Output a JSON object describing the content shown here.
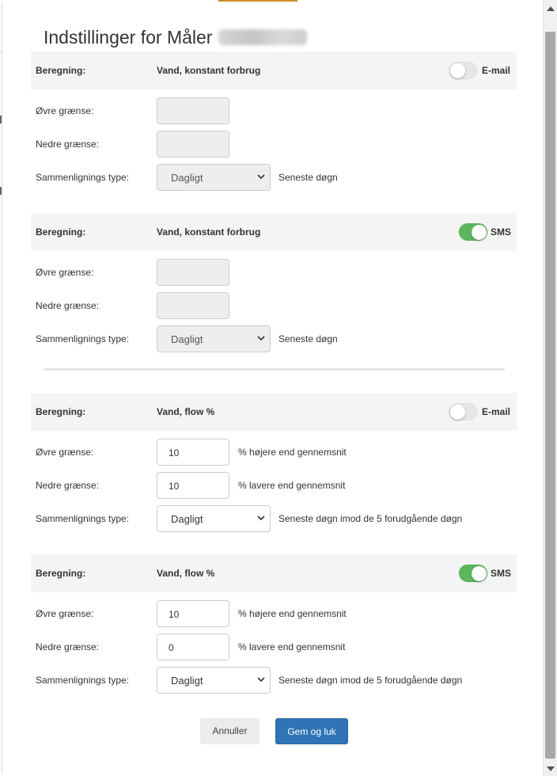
{
  "dialog": {
    "title": "Indstillinger for Måler",
    "meter_id_redacted": true
  },
  "labels": {
    "calc": "Beregning:",
    "upper": "Øvre grænse:",
    "lower": "Nedre grænse:",
    "compare": "Sammenlignings type:"
  },
  "sections": [
    {
      "calc_value": "Vand, konstant forbrug",
      "enabled": false,
      "channel": "E-mail",
      "upper_value": "",
      "upper_hint": "",
      "lower_value": "",
      "lower_hint": "",
      "compare_value": "Dagligt",
      "compare_hint": "Seneste døgn",
      "inputs_disabled": true
    },
    {
      "calc_value": "Vand, konstant forbrug",
      "enabled": true,
      "channel": "SMS",
      "upper_value": "",
      "upper_hint": "",
      "lower_value": "",
      "lower_hint": "",
      "compare_value": "Dagligt",
      "compare_hint": "Seneste døgn",
      "inputs_disabled": true
    },
    {
      "calc_value": "Vand, flow %",
      "enabled": false,
      "channel": "E-mail",
      "upper_value": "10",
      "upper_hint": "% højere end gennemsnit",
      "lower_value": "10",
      "lower_hint": "% lavere end gennemsnit",
      "compare_value": "Dagligt",
      "compare_hint": "Seneste døgn imod de 5 forudgående døgn",
      "inputs_disabled": false
    },
    {
      "calc_value": "Vand, flow %",
      "enabled": true,
      "channel": "SMS",
      "upper_value": "10",
      "upper_hint": "% højere end gennemsnit",
      "lower_value": "0",
      "lower_hint": "% lavere end gennemsnit",
      "compare_value": "Dagligt",
      "compare_hint": "Seneste døgn imod de 5 forudgående døgn",
      "inputs_disabled": false
    }
  ],
  "buttons": {
    "cancel": "Annuller",
    "save": "Gem og luk"
  },
  "colors": {
    "toggle_on": "#5cb85c",
    "toggle_off": "#e6e6e6",
    "primary": "#2f74b5",
    "header_bg": "#f4f4f4"
  }
}
